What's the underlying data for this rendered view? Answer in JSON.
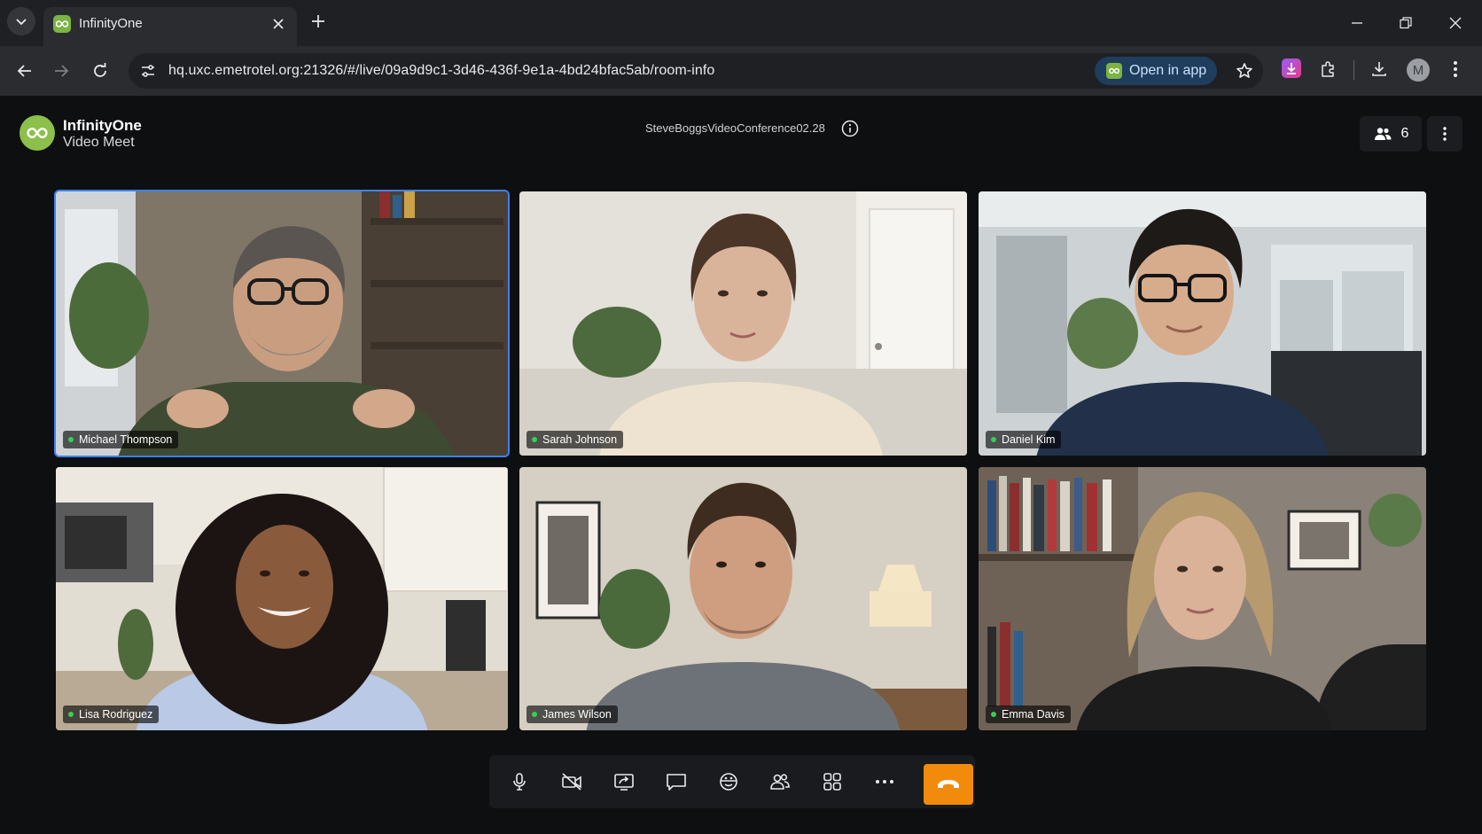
{
  "browser": {
    "tab_title": "InfinityOne",
    "url": "hq.uxc.emetrotel.org:21326/#/live/09a9d9c1-3d46-436f-9e1a-4bd24bfac5ab/room-info",
    "open_in_app_label": "Open in app",
    "profile_initial": "M"
  },
  "app": {
    "brand_name": "InfinityOne",
    "brand_subtitle": "Video Meet",
    "room_name": "SteveBoggsVideoConference02.28",
    "participant_count": "6"
  },
  "participants": [
    {
      "name": "Michael Thompson",
      "active_speaker": true,
      "status": "online"
    },
    {
      "name": "Sarah Johnson",
      "active_speaker": false,
      "status": "online"
    },
    {
      "name": "Daniel Kim",
      "active_speaker": false,
      "status": "online"
    },
    {
      "name": "Lisa Rodriguez",
      "active_speaker": false,
      "status": "online"
    },
    {
      "name": "James Wilson",
      "active_speaker": false,
      "status": "online"
    },
    {
      "name": "Emma Davis",
      "active_speaker": false,
      "status": "online"
    }
  ],
  "controls": [
    {
      "icon": "microphone-icon"
    },
    {
      "icon": "camera-off-icon"
    },
    {
      "icon": "screen-share-icon"
    },
    {
      "icon": "chat-icon"
    },
    {
      "icon": "background-effects-icon"
    },
    {
      "icon": "participants-icon"
    },
    {
      "icon": "grid-layout-icon"
    },
    {
      "icon": "more-horizontal-icon"
    },
    {
      "icon": "hang-up-icon"
    }
  ],
  "colors": {
    "brand_green": "#8cc04b",
    "active_speaker_border": "#3b82f6",
    "hang_up": "#f28b0c",
    "status_online": "#34d058"
  }
}
